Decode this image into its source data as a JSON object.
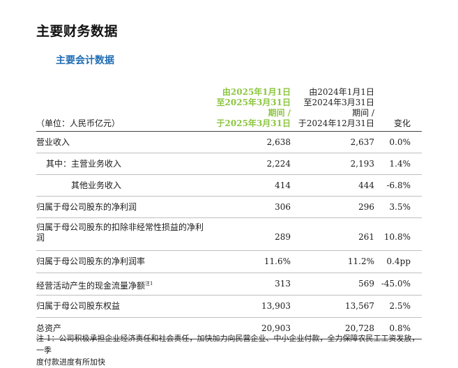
{
  "page_title": "主要财务数据",
  "section_title": "主要会计数据",
  "header": {
    "unit": "（单位：人民币亿元）",
    "col1": [
      "由2025年1月1日",
      "至2025年3月31日",
      "期间 /",
      "于2025年3月31日"
    ],
    "col2": [
      "由2024年1月1日",
      "至2024年3月31日",
      "期间 /",
      "于2024年12月31日"
    ],
    "col3": "变化"
  },
  "rows": [
    {
      "label": "营业收入",
      "v1": "2,638",
      "v2": "2,637",
      "v3": "0.0%"
    },
    {
      "label": "其中：主营业务收入",
      "v1": "2,224",
      "v2": "2,193",
      "v3": "1.4%"
    },
    {
      "label": "其他业务收入",
      "v1": "414",
      "v2": "444",
      "v3": "-6.8%"
    },
    {
      "label": "归属于母公司股东的净利润",
      "v1": "306",
      "v2": "296",
      "v3": "3.5%"
    },
    {
      "label_line1": "归属于母公司股东的扣除非经常性损益的净利",
      "label_line2": "润",
      "v1": "289",
      "v2": "261",
      "v3": "10.8%"
    },
    {
      "label": "归属于母公司股东的净利润率",
      "v1": "11.6%",
      "v2": "11.2%",
      "v3": "0.4pp"
    },
    {
      "label": "经营活动产生的现金流量净额",
      "sup": "注1",
      "v1": "313",
      "v2": "569",
      "v3": "-45.0%"
    },
    {
      "label": "归属于母公司股东权益",
      "v1": "13,903",
      "v2": "13,567",
      "v3": "2.5%"
    },
    {
      "label": "总资产",
      "v1": "20,903",
      "v2": "20,728",
      "v3": "0.8%"
    }
  ],
  "note": {
    "line1": "注 1：公司积极承担企业经济责任和社会责任，加快加力向民营企业、中小企业付款，全力保障农民工工资发放，一季",
    "line2": "度付款进度有所加快"
  }
}
